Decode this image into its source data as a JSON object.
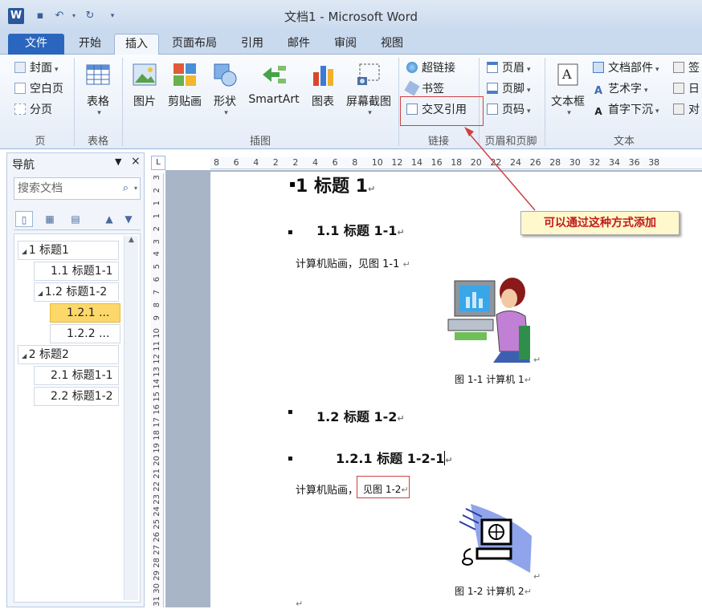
{
  "window": {
    "title": "文档1 - Microsoft Word",
    "app_icon_letter": "W"
  },
  "tabs": [
    "文件",
    "开始",
    "插入",
    "页面布局",
    "引用",
    "邮件",
    "审阅",
    "视图"
  ],
  "ribbon": {
    "pages": {
      "items": [
        "封面",
        "空白页",
        "分页"
      ],
      "label": "页"
    },
    "table": {
      "button": "表格",
      "label": "表格"
    },
    "illustrations": {
      "items": [
        "图片",
        "剪贴画",
        "形状",
        "SmartArt",
        "图表",
        "屏幕截图"
      ],
      "label": "插图"
    },
    "links": {
      "items": [
        "超链接",
        "书签",
        "交叉引用"
      ],
      "label": "链接"
    },
    "header_footer": {
      "items": [
        "页眉",
        "页脚",
        "页码"
      ],
      "label": "页眉和页脚"
    },
    "text": {
      "textbox": "文本框",
      "items": [
        "文档部件",
        "艺术字",
        "首字下沉"
      ],
      "right_items": [
        "签",
        "日",
        "对"
      ],
      "label": "文本"
    }
  },
  "navigation": {
    "title": "导航",
    "search_placeholder": "搜索文档",
    "outline": [
      {
        "label": "1 标题1",
        "level": 1,
        "expanded": true,
        "selected": false
      },
      {
        "label": "1.1 标题1-1",
        "level": 2,
        "expanded": false,
        "selected": false
      },
      {
        "label": "1.2 标题1-2",
        "level": 2,
        "expanded": true,
        "selected": false
      },
      {
        "label": "1.2.1 ...",
        "level": 3,
        "expanded": false,
        "selected": true
      },
      {
        "label": "1.2.2 ...",
        "level": 3,
        "expanded": false,
        "selected": false
      },
      {
        "label": "2 标题2",
        "level": 1,
        "expanded": true,
        "selected": false
      },
      {
        "label": "2.1 标题1-1",
        "level": 2,
        "expanded": false,
        "selected": false
      },
      {
        "label": "2.2 标题1-2",
        "level": 2,
        "expanded": false,
        "selected": false
      }
    ]
  },
  "ruler": {
    "horizontal_ticks": [
      "8",
      "6",
      "4",
      "2",
      "2",
      "4",
      "6",
      "8",
      "10",
      "12",
      "14",
      "16",
      "18",
      "20",
      "22",
      "24",
      "26",
      "28",
      "30",
      "32",
      "34",
      "36",
      "38"
    ],
    "vertical_ticks": [
      "3",
      "2",
      "1",
      "1",
      "2",
      "3",
      "4",
      "5",
      "6",
      "7",
      "8",
      "9",
      "10",
      "11",
      "12",
      "13",
      "14",
      "15",
      "16",
      "17",
      "18",
      "19",
      "20",
      "21",
      "22",
      "23",
      "24",
      "25",
      "26",
      "27",
      "28",
      "29",
      "30",
      "31"
    ]
  },
  "document": {
    "h1": "1 标题 1",
    "h1_1": "1.1 标题 1-1",
    "para1": "计算机贴画，见图 1-1",
    "caption1": "图 1-1 计算机 1",
    "h1_2": "1.2 标题 1-2",
    "h1_2_1": "1.2.1 标题 1-2-1",
    "para2_prefix": "计算机贴画，",
    "para2_ref": "见图 1-2",
    "caption2": "图 1-2 计算机 2",
    "para_mark": "↵"
  },
  "annotation": {
    "callout": "可以通过这种方式添加"
  },
  "colors": {
    "file_tab": "#2a66bd",
    "highlight_box": "#d04040",
    "callout_bg": "#fff8cc",
    "callout_text": "#c31a1a",
    "nav_selected": "#fcd86b"
  }
}
